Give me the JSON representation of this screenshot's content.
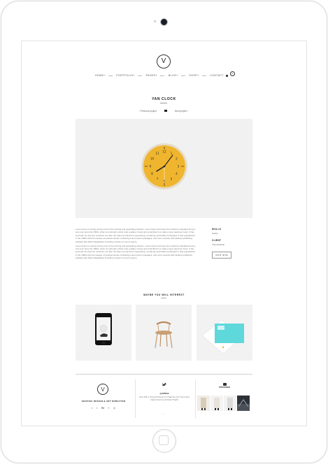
{
  "header": {
    "logo_glyph": "V",
    "nav": [
      {
        "label": "HOME+"
      },
      {
        "label": "PORTFOLIO+"
      },
      {
        "label": "PAGES+"
      },
      {
        "label": "BLOG+"
      },
      {
        "label": "SHOP+"
      },
      {
        "label": "CONTACT"
      }
    ],
    "cart_count": "0"
  },
  "project": {
    "title": "YAN CLOCK",
    "prev_label": "Previous project",
    "next_label": "Next project"
  },
  "description": [
    "Lorem Ipsum is simply dummy text of the printing and typesetting industry. Lorem Ipsum has been the industry's standard dummy text ever since the 1500s, when an unknown printer took a galley of type and scrambled it to make a type specimen book. It has survived not only five centuries, but also the leap into electronic typesetting, remaining essentially unchanged. It was popularised in the 1960s with the release of Letraset sheets containing Lorem Ipsum passages, and more recently with desktop publishing software like Aldus PageMaker including versions of Lorem Ipsum.",
    "Lorem Ipsum is simply dummy text of the printing and typesetting industry. Lorem Ipsum has been the industry's standard dummy text ever since the 1500s, when an unknown printer took a galley of type and scrambled it to make a type specimen book. It has survived not only five centuries, but also the leap into electronic typesetting, remaining essentially unchanged. It was popularised in the 1960s with the release of Letraset sheets containing Lorem Ipsum passages, and more recently with desktop publishing software like Aldus PageMaker including versions of Lorem Ipsum."
  ],
  "meta": {
    "skills_label": "SKILLS",
    "skills_value": "Adobe",
    "client_label": "CLIENT",
    "client_value": "ThemeNectar",
    "visit_label": "VISIT SITE"
  },
  "related": {
    "title": "MAYBE YOU WILL INTEREST"
  },
  "footer": {
    "tagline": "GRAPHIC DESIGN & ART DIRECTION",
    "social": [
      "•",
      "•",
      "Be",
      "t",
      "◎"
    ],
    "twitter_handle": "@APPLE",
    "tweet": "Now 3M is Using Pinterest to Organize Our Trend and Ideas http://t.co/mhwsrYTsqM",
    "instagram_label": "INSTAGRAM",
    "twitter_nav": "‹ ›",
    "instagram_nav": "‹ ›"
  },
  "colors": {
    "clock_face": "#f0b52e",
    "clock_rim": "#e6dcc8",
    "hero_bg": "#f1f1f1",
    "accent_cyan": "#5fd8dc"
  }
}
